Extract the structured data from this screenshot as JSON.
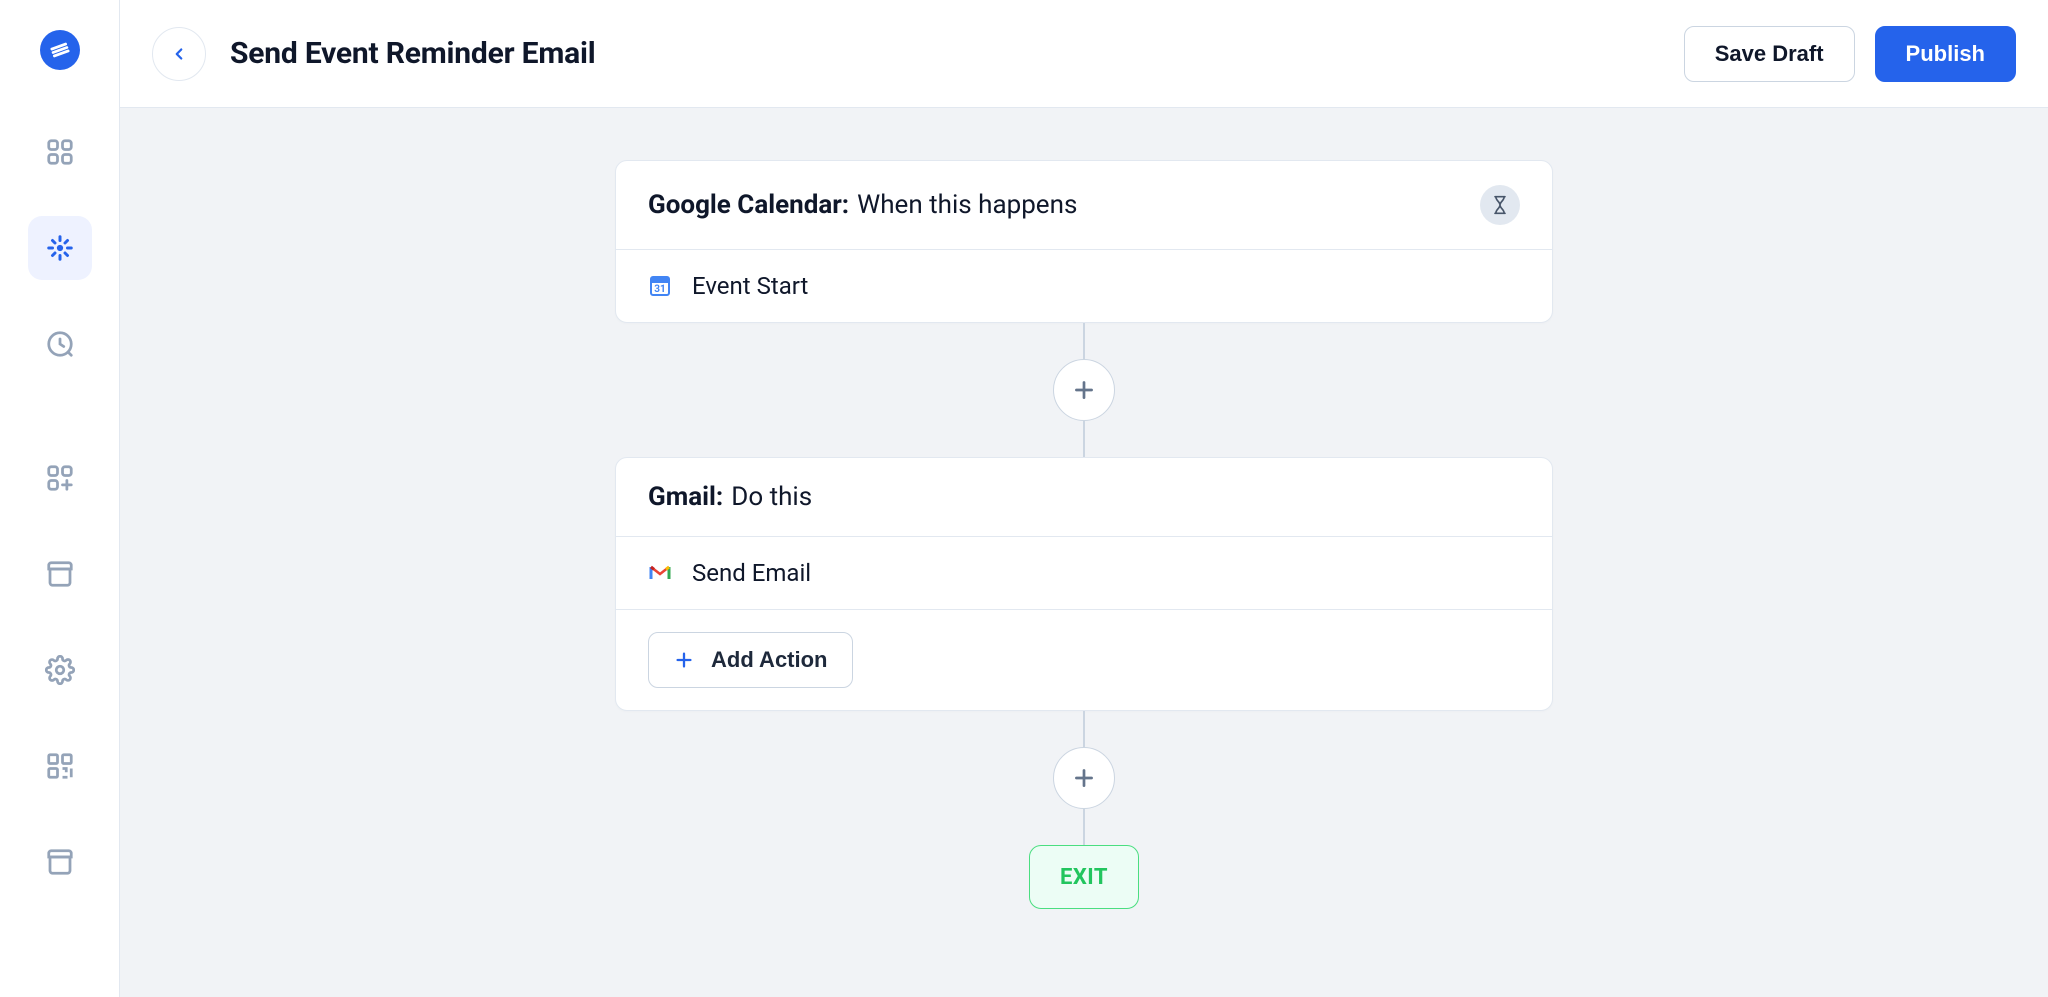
{
  "header": {
    "title": "Send Event Reminder Email",
    "save_draft_label": "Save Draft",
    "publish_label": "Publish"
  },
  "sidebar": {
    "items": [
      {
        "name": "apps",
        "active": false
      },
      {
        "name": "workflow",
        "active": true
      },
      {
        "name": "history",
        "active": false
      },
      {
        "name": "add-app",
        "active": false
      },
      {
        "name": "archive",
        "active": false
      },
      {
        "name": "settings",
        "active": false
      },
      {
        "name": "qr",
        "active": false
      },
      {
        "name": "archive-2",
        "active": false
      }
    ]
  },
  "flow": {
    "trigger": {
      "service": "Google Calendar:",
      "hint": "When this happens",
      "event_label": "Event Start"
    },
    "action": {
      "service": "Gmail:",
      "hint": "Do this",
      "event_label": "Send Email",
      "add_action_label": "Add Action"
    },
    "exit_label": "EXIT"
  }
}
